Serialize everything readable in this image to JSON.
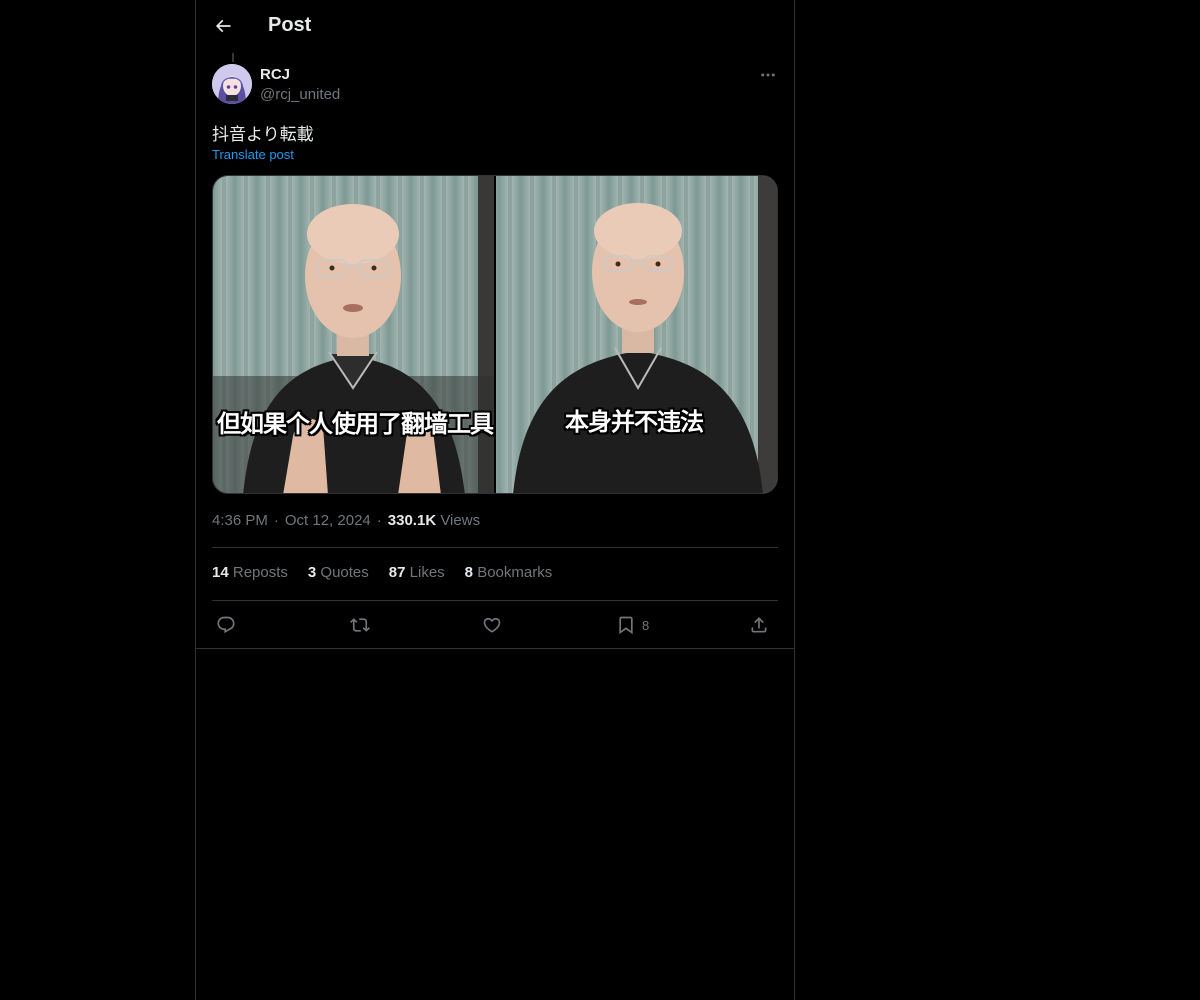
{
  "header": {
    "title": "Post"
  },
  "post": {
    "author_name": "RCJ",
    "author_handle": "@rcj_united",
    "text": "抖音より転載",
    "translate_label": "Translate post",
    "media": {
      "caption_left": "但如果个人使用了翻墙工具",
      "caption_right": "本身并不违法"
    },
    "time": "4:36 PM",
    "date": "Oct 12, 2024",
    "views_count": "330.1K",
    "views_label": "Views"
  },
  "stats": {
    "reposts_count": "14",
    "reposts_label": "Reposts",
    "quotes_count": "3",
    "quotes_label": "Quotes",
    "likes_count": "87",
    "likes_label": "Likes",
    "bookmarks_count": "8",
    "bookmarks_label": "Bookmarks"
  },
  "actions": {
    "bookmark_count": "8"
  },
  "icons": [
    "back-arrow-icon",
    "more-icon",
    "reply-icon",
    "repost-icon",
    "like-icon",
    "bookmark-icon",
    "share-icon"
  ],
  "colors": {
    "background": "#000000",
    "text": "#e7e9ea",
    "muted": "#71767b",
    "link": "#1d9bf0",
    "border": "#2f3336"
  }
}
